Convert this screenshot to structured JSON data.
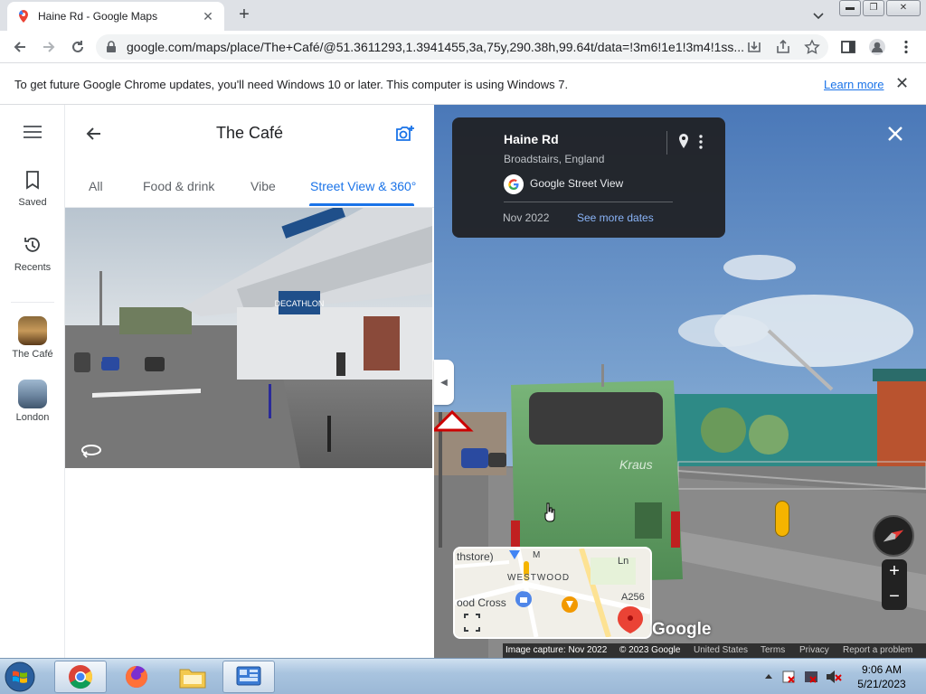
{
  "browser": {
    "tab_title": "Haine Rd - Google Maps",
    "url": "google.com/maps/place/The+Café/@51.3611293,1.3941455,3a,75y,290.38h,99.64t/data=!3m6!1e1!3m4!1ss...",
    "infobar_message": "To get future Google Chrome updates, you'll need Windows 10 or later. This computer is using Windows 7.",
    "infobar_link": "Learn more"
  },
  "rail": {
    "saved": "Saved",
    "recents": "Recents",
    "recent1": "The Café",
    "recent2": "London"
  },
  "panel": {
    "title": "The Café",
    "tabs": [
      "All",
      "Food & drink",
      "Vibe",
      "Street View & 360°"
    ],
    "active_tab": "Street View & 360°",
    "photo_signs": [
      "DECATHLON"
    ]
  },
  "streetview": {
    "place": "Haine Rd",
    "subtitle": "Broadstairs, England",
    "source": "Google Street View",
    "date": "Nov 2022",
    "more_dates": "See more dates",
    "bus_text": "Kraus",
    "minimap_labels": [
      "thstore)",
      "WESTWOOD",
      "ood Cross",
      "A256",
      "Ln",
      "M"
    ],
    "watermark": "Google",
    "footer": {
      "capture": "Image capture: Nov 2022",
      "copyright": "© 2023 Google",
      "country": "United States",
      "terms": "Terms",
      "privacy": "Privacy",
      "report": "Report a problem"
    }
  },
  "taskbar": {
    "time": "9:06 AM",
    "date": "5/21/2023"
  },
  "colors": {
    "accent": "#1a73e8",
    "card_bg": "#202124",
    "bus_green": "#6fae6f"
  }
}
